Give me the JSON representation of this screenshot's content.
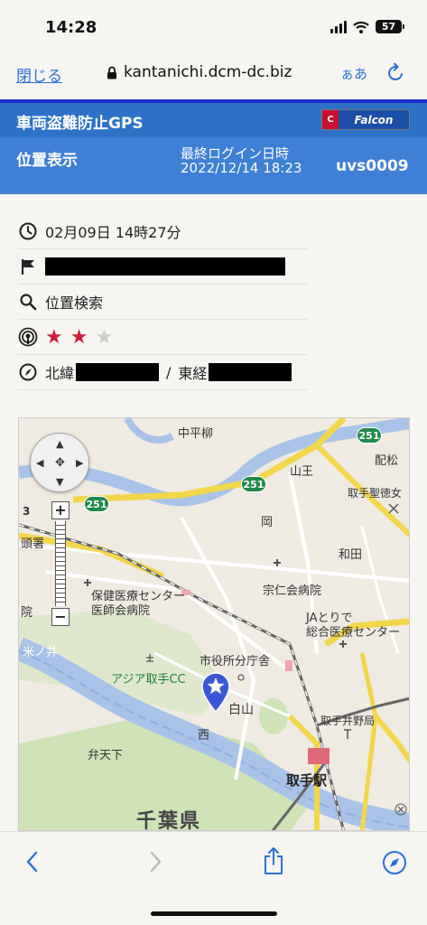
{
  "status_bar": {
    "time": "14:28",
    "battery": "57"
  },
  "browser": {
    "close_label": "閉じる",
    "url": "kantanichi.dcm-dc.biz",
    "text_size_label": "ぁあ"
  },
  "app": {
    "title": "車両盗難防止GPS",
    "brand": {
      "mark": "C",
      "name": "Falcon"
    },
    "section_title": "位置表示",
    "last_login_label": "最終ログイン日時",
    "last_login_value": "2022/12/14 18:23",
    "user_id": "uvs0009"
  },
  "info": {
    "datetime": "02月09日 14時27分",
    "search_label": "位置検索",
    "signal_strength": {
      "filled": 2,
      "total": 3
    },
    "lat_label": "北緯",
    "separator": "/",
    "lon_label": "東経"
  },
  "map": {
    "labels": {
      "nakahirayanagi": "中平柳",
      "haimatsu": "配松",
      "sanno": "山王",
      "toride_seitoku": "取手聖徳女",
      "oka": "岡",
      "wada": "和田",
      "keisatsu": "頭署",
      "hoken_center": "保健医療センター",
      "ishikai_hospital": "医師会病院",
      "soujinkai_hospital": "宗仁会病院",
      "ja_toride": "JAとりで",
      "sogo_center": "総合医療センター",
      "in": "院",
      "yonenoi": "米ノ井",
      "city_office": "市役所分庁舎",
      "asia_cc": "アジア取手CC",
      "hakusan": "白山",
      "nishi": "西",
      "toride_inokubo": "取手井野局",
      "bentenshita": "弁天下",
      "toride_station": "取手駅",
      "chiba": "千葉県",
      "num_3": "3"
    },
    "routes": [
      "251",
      "251",
      "251"
    ],
    "colors": {
      "land": "#efebe2",
      "river": "#a9c3e8",
      "park": "#cfe3b6",
      "major_road": "#f2d64b",
      "road": "#ffffff",
      "rail": "#666666",
      "pin": "#3a58d6"
    }
  }
}
